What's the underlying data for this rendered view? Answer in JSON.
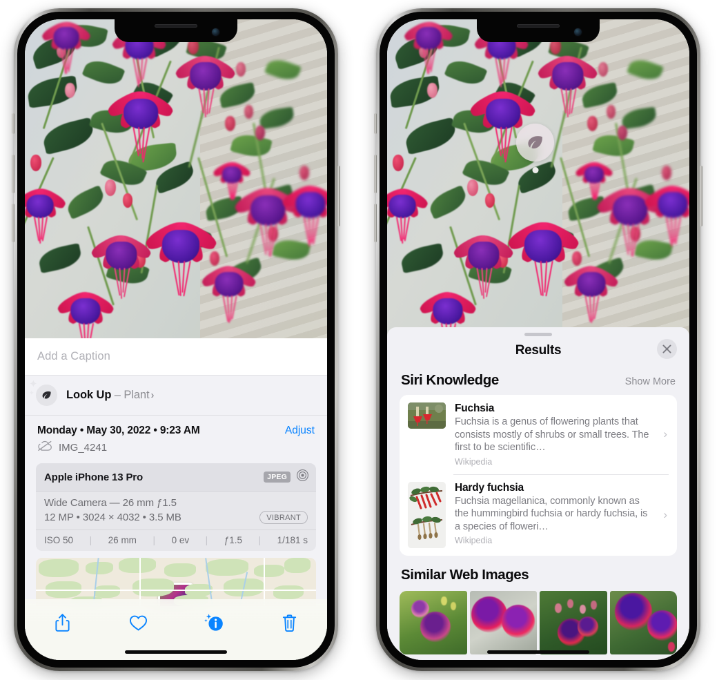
{
  "left_phone": {
    "name": "iphone-photos-info",
    "caption": {
      "placeholder": "Add a Caption",
      "value": ""
    },
    "look_up": {
      "label": "Look Up",
      "dash": "–",
      "subject": "Plant",
      "chevron": "›",
      "icon": "leaf-icon"
    },
    "date_line": "Monday • May 30, 2022 • 9:23 AM",
    "adjust_label": "Adjust",
    "file_name": "IMG_4241",
    "cloud_icon": "cloud-slash-icon",
    "exif": {
      "device": "Apple iPhone 13 Pro",
      "format_tag": "JPEG",
      "raw_icon": "aperture-icon",
      "lens_line": "Wide Camera — 26 mm ƒ1.5",
      "size_line": "12 MP • 3024 × 4032 • 3.5 MB",
      "style_tag": "VIBRANT",
      "stats": [
        "ISO 50",
        "26 mm",
        "0 ev",
        "ƒ1.5",
        "1/181 s"
      ]
    },
    "map": {
      "pin_label": "photo-location-pin"
    },
    "toolbar": [
      {
        "name": "share-button",
        "icon": "share-icon"
      },
      {
        "name": "favorite-button",
        "icon": "heart-icon"
      },
      {
        "name": "info-button",
        "icon": "info-sparkle-icon"
      },
      {
        "name": "delete-button",
        "icon": "trash-icon"
      }
    ],
    "accent_color": "#0a84ff"
  },
  "right_phone": {
    "name": "iphone-visual-lookup-results",
    "visual_badge": {
      "icon": "leaf-icon",
      "label": "visual-look-up-badge"
    },
    "sheet": {
      "title": "Results",
      "close_label": "×",
      "sections": [
        {
          "title": "Siri Knowledge",
          "action": "Show More",
          "items": [
            {
              "title": "Fuchsia",
              "description": "Fuchsia is a genus of flowering plants that consists mostly of shrubs or small trees. The first to be scientific…",
              "source": "Wikipedia",
              "chevron": "›"
            },
            {
              "title": "Hardy fuchsia",
              "description": "Fuchsia magellanica, commonly known as the hummingbird fuchsia or hardy fuchsia, is a species of floweri…",
              "source": "Wikipedia",
              "chevron": "›"
            }
          ]
        },
        {
          "title": "Similar Web Images",
          "thumbnails": [
            "fuchsia-web-image-1",
            "fuchsia-web-image-2",
            "fuchsia-web-image-3",
            "fuchsia-web-image-4"
          ]
        }
      ]
    }
  }
}
